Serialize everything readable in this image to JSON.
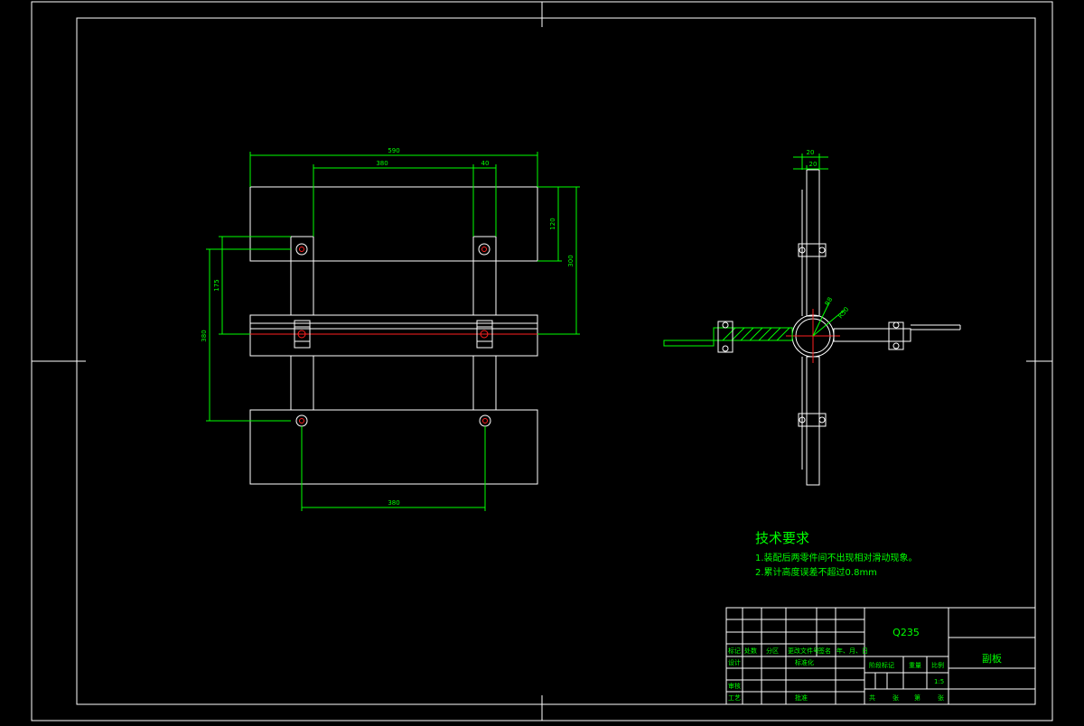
{
  "dimensions": {
    "front_overall_width": "590",
    "front_top_spacing": "380",
    "front_top_arm": "40",
    "front_right_short": "120",
    "front_right_tall": "300",
    "front_left_short": "175",
    "front_left_tall": "380",
    "front_bottom_spacing": "380",
    "side_top_a": "20",
    "side_top_b": "20",
    "side_radius_a": "R8",
    "side_radius_b": "R50"
  },
  "notes": {
    "heading": "技术要求",
    "items": [
      "1.装配后两零件间不出现相对滑动现象。",
      "2.累计高度误差不超过0.8mm"
    ]
  },
  "title_block": {
    "material": "Q235",
    "drawing_name": "副板",
    "scale": "1:5",
    "labels": {
      "mark": "标记",
      "count": "处数",
      "zone": "分区",
      "change_doc": "更改文件号",
      "sign": "签名",
      "date": "年、月、日",
      "design": "设计",
      "standard": "标准化",
      "stage_mark": "阶段标记",
      "weight": "重量",
      "scale_label": "比例",
      "review": "审核",
      "process": "工艺",
      "approve": "批准",
      "total": "共",
      "sheet": "张",
      "page_no": "第",
      "page_sheet": "张"
    }
  }
}
